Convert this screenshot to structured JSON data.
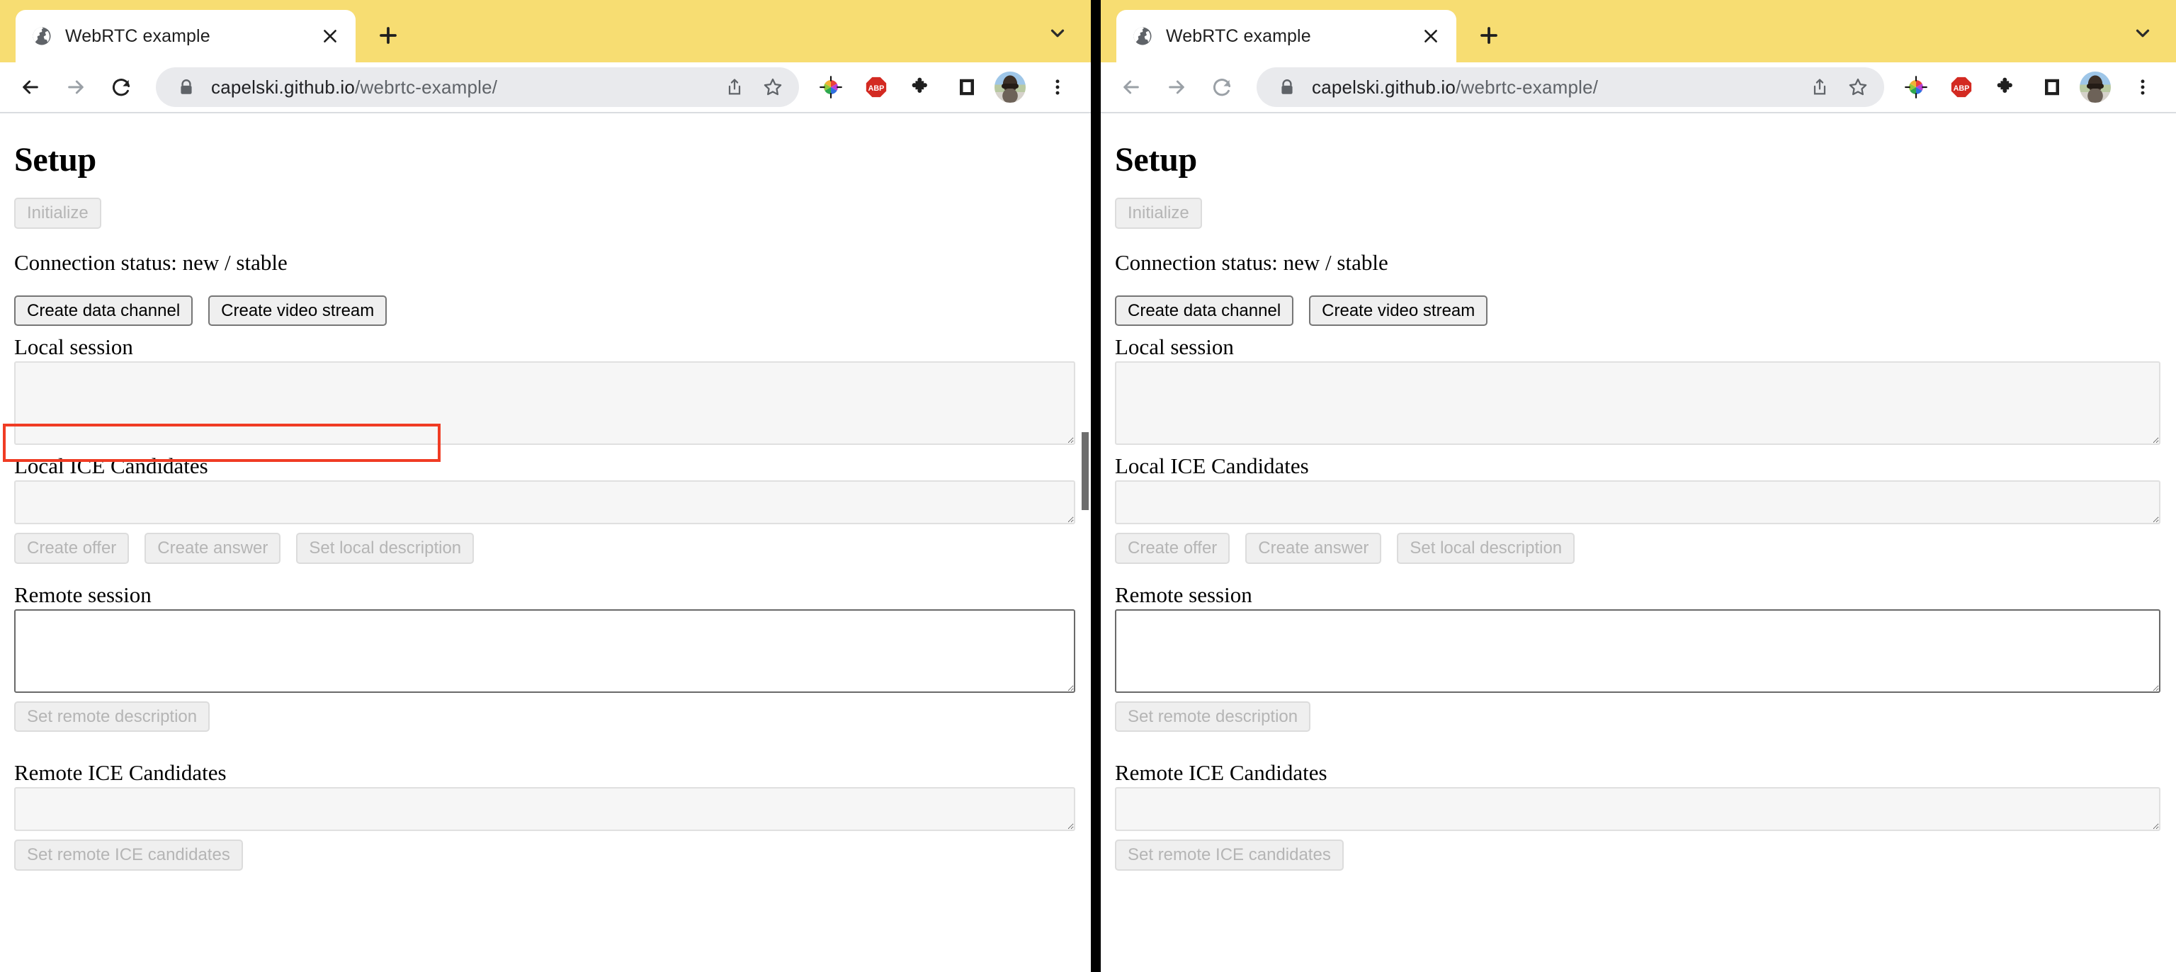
{
  "windows": [
    {
      "id": "left",
      "browser": {
        "tab": {
          "title": "WebRTC example",
          "favicon_icon": "globe-icon",
          "close_icon": "close-icon"
        },
        "new_tab_icon": "plus-icon",
        "tabstrip_chevron_icon": "chevron-down-icon",
        "nav": {
          "back_icon": "back-arrow-icon",
          "back_enabled": true,
          "forward_icon": "forward-arrow-icon",
          "forward_enabled": false,
          "reload_icon": "reload-icon",
          "reload_enabled": true
        },
        "omnibox": {
          "lock_icon": "lock-icon",
          "url_host": "capelski.github.io",
          "url_path": "/webrtc-example/",
          "share_icon": "share-icon",
          "bookmark_icon": "star-icon"
        },
        "extensions": [
          {
            "icon": "color-picker-icon",
            "label": "Color picker"
          },
          {
            "icon": "adblock-plus-icon",
            "label": "ABP"
          },
          {
            "icon": "puzzle-piece-icon",
            "label": "Extensions"
          },
          {
            "icon": "reading-list-icon",
            "label": "Reading list"
          }
        ],
        "profile_icon": "avatar",
        "menu_icon": "three-dot-menu-icon"
      },
      "page": {
        "title": "Setup",
        "initialize_button": "Initialize",
        "initialize_disabled": true,
        "status_text": "Connection status: new / stable",
        "create_data_channel_button": "Create data channel",
        "create_video_stream_button": "Create video stream",
        "local_session_label": "Local session",
        "local_session_value": "",
        "local_ice_label": "Local ICE Candidates",
        "local_ice_value": "",
        "create_offer_button": "Create offer",
        "create_answer_button": "Create answer",
        "set_local_description_button": "Set local description",
        "remote_session_label": "Remote session",
        "remote_session_value": "",
        "set_remote_description_button": "Set remote description",
        "remote_ice_label": "Remote ICE Candidates",
        "remote_ice_value": "",
        "set_remote_ice_button": "Set remote ICE candidates"
      },
      "annotation": {
        "highlight_color": "#f03c24",
        "target": "create data channel / create video stream buttons"
      },
      "scrollbar_visible": true
    },
    {
      "id": "right",
      "browser": {
        "tab": {
          "title": "WebRTC example",
          "favicon_icon": "globe-icon",
          "close_icon": "close-icon"
        },
        "new_tab_icon": "plus-icon",
        "tabstrip_chevron_icon": "chevron-down-icon",
        "nav": {
          "back_icon": "back-arrow-icon",
          "back_enabled": false,
          "forward_icon": "forward-arrow-icon",
          "forward_enabled": false,
          "reload_icon": "reload-icon",
          "reload_enabled": false
        },
        "omnibox": {
          "lock_icon": "lock-icon",
          "url_host": "capelski.github.io",
          "url_path": "/webrtc-example/",
          "share_icon": "share-icon",
          "bookmark_icon": "star-icon"
        },
        "extensions": [
          {
            "icon": "color-picker-icon",
            "label": "Color picker"
          },
          {
            "icon": "adblock-plus-icon",
            "label": "ABP"
          },
          {
            "icon": "puzzle-piece-icon",
            "label": "Extensions"
          },
          {
            "icon": "reading-list-icon",
            "label": "Reading list"
          }
        ],
        "profile_icon": "avatar",
        "menu_icon": "three-dot-menu-icon"
      },
      "page": {
        "title": "Setup",
        "initialize_button": "Initialize",
        "initialize_disabled": true,
        "status_text": "Connection status: new / stable",
        "create_data_channel_button": "Create data channel",
        "create_video_stream_button": "Create video stream",
        "local_session_label": "Local session",
        "local_session_value": "",
        "local_ice_label": "Local ICE Candidates",
        "local_ice_value": "",
        "create_offer_button": "Create offer",
        "create_answer_button": "Create answer",
        "set_local_description_button": "Set local description",
        "remote_session_label": "Remote session",
        "remote_session_value": "",
        "set_remote_description_button": "Set remote description",
        "remote_ice_label": "Remote ICE Candidates",
        "remote_ice_value": "",
        "set_remote_ice_button": "Set remote ICE candidates"
      },
      "annotation": null,
      "scrollbar_visible": false
    }
  ],
  "theme": {
    "tabstrip_color": "#f7dd72",
    "omnibox_color": "#e9eaed",
    "divider_color": "#000000"
  }
}
